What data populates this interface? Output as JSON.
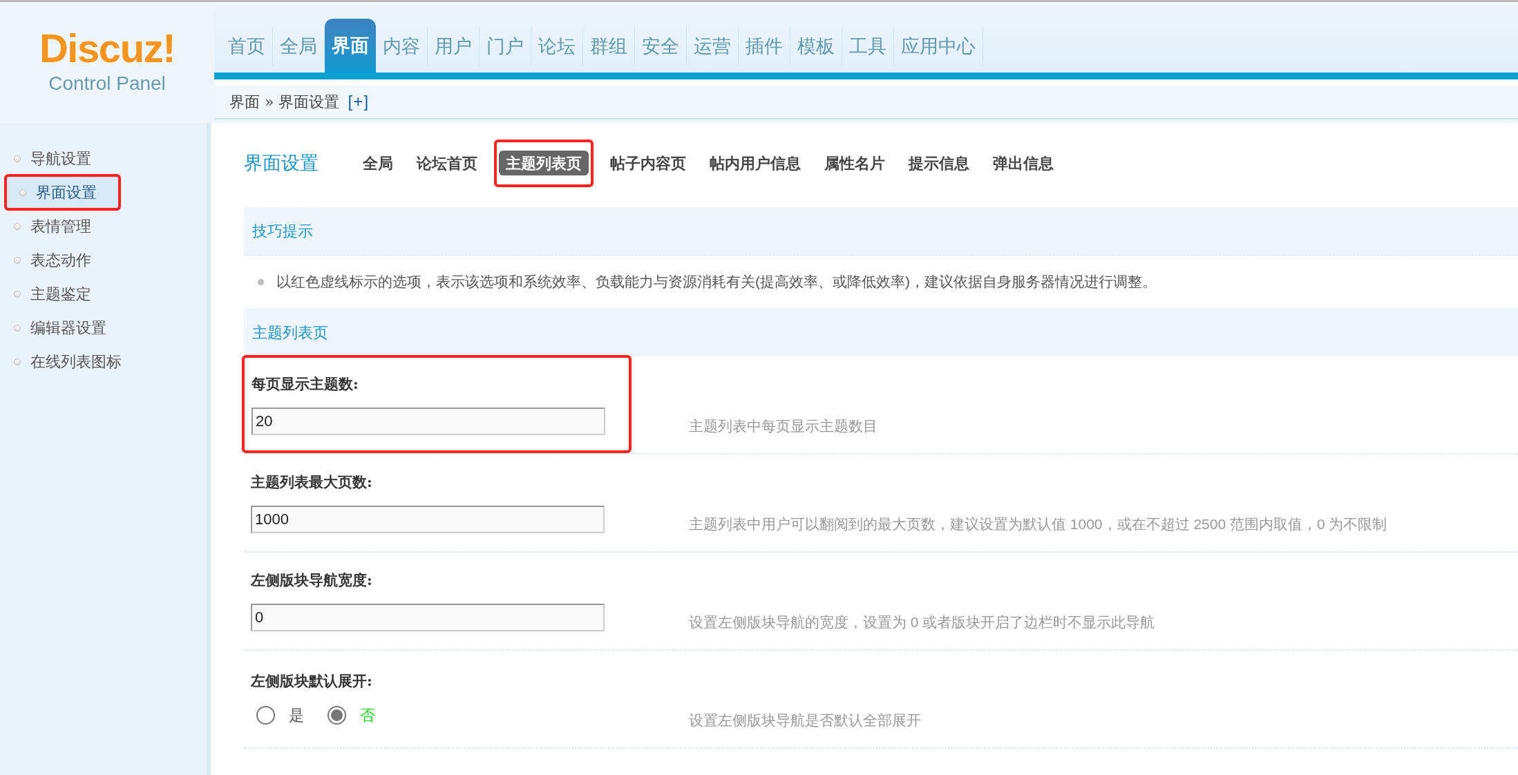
{
  "logo": {
    "title": "Discuz!",
    "subtitle": "Control Panel"
  },
  "top_nav": [
    {
      "label": "首页",
      "selected": false
    },
    {
      "label": "全局",
      "selected": false
    },
    {
      "label": "界面",
      "selected": true
    },
    {
      "label": "内容",
      "selected": false
    },
    {
      "label": "用户",
      "selected": false
    },
    {
      "label": "门户",
      "selected": false
    },
    {
      "label": "论坛",
      "selected": false
    },
    {
      "label": "群组",
      "selected": false
    },
    {
      "label": "安全",
      "selected": false
    },
    {
      "label": "运营",
      "selected": false
    },
    {
      "label": "插件",
      "selected": false
    },
    {
      "label": "模板",
      "selected": false
    },
    {
      "label": "工具",
      "selected": false
    },
    {
      "label": "应用中心",
      "selected": false
    }
  ],
  "breadcrumb": {
    "path": "界面 » 界面设置",
    "add": "[+]"
  },
  "sidebar": {
    "items": [
      {
        "label": "导航设置",
        "selected": false,
        "highlighted": false
      },
      {
        "label": "界面设置",
        "selected": true,
        "highlighted": true
      },
      {
        "label": "表情管理",
        "selected": false,
        "highlighted": false
      },
      {
        "label": "表态动作",
        "selected": false,
        "highlighted": false
      },
      {
        "label": "主题鉴定",
        "selected": false,
        "highlighted": false
      },
      {
        "label": "编辑器设置",
        "selected": false,
        "highlighted": false
      },
      {
        "label": "在线列表图标",
        "selected": false,
        "highlighted": false
      }
    ]
  },
  "page_title": "界面设置",
  "sub_tabs": [
    {
      "label": "全局",
      "selected": false,
      "highlighted": false
    },
    {
      "label": "论坛首页",
      "selected": false,
      "highlighted": false
    },
    {
      "label": "主题列表页",
      "selected": true,
      "highlighted": true
    },
    {
      "label": "帖子内容页",
      "selected": false,
      "highlighted": false
    },
    {
      "label": "帖内用户信息",
      "selected": false,
      "highlighted": false
    },
    {
      "label": "属性名片",
      "selected": false,
      "highlighted": false
    },
    {
      "label": "提示信息",
      "selected": false,
      "highlighted": false
    },
    {
      "label": "弹出信息",
      "selected": false,
      "highlighted": false
    }
  ],
  "tips": {
    "title": "技巧提示",
    "items": [
      "以红色虚线标示的选项，表示该选项和系统效率、负载能力与资源消耗有关(提高效率、或降低效率)，建议依据自身服务器情况进行调整。"
    ]
  },
  "section_title": "主题列表页",
  "settings": [
    {
      "kind": "text",
      "label": "每页显示主题数:",
      "value": "20",
      "description": "主题列表中每页显示主题数目",
      "highlighted": true
    },
    {
      "kind": "text",
      "label": "主题列表最大页数:",
      "value": "1000",
      "description": "主题列表中用户可以翻阅到的最大页数，建议设置为默认值 1000，或在不超过 2500 范围内取值，0 为不限制",
      "highlighted": false
    },
    {
      "kind": "text",
      "label": "左侧版块导航宽度:",
      "value": "0",
      "description": "设置左侧版块导航的宽度，设置为 0 或者版块开启了边栏时不显示此导航",
      "highlighted": false
    },
    {
      "kind": "radio",
      "label": "左侧版块默认展开:",
      "options": [
        {
          "label": "是",
          "selected": false
        },
        {
          "label": "否",
          "selected": true
        }
      ],
      "description": "设置左侧版块导航是否默认全部展开",
      "highlighted": false
    }
  ]
}
